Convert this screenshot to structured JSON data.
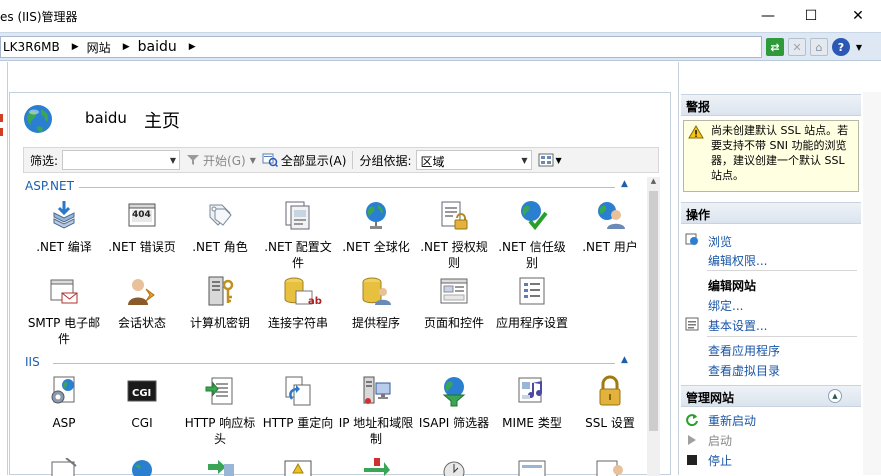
{
  "window": {
    "title": "es (IIS)管理器",
    "minimize": "—",
    "maximize": "☐",
    "close": "✕"
  },
  "address": {
    "segments": [
      "LK3R6MB",
      "网站",
      "baidu"
    ]
  },
  "header": {
    "site_name": "baidu",
    "title": "主页"
  },
  "filterbar": {
    "filter_label": "筛选:",
    "start_label": "开始(G)",
    "show_all_label": "全部显示(A)",
    "group_label": "分组依据:",
    "group_value": "区域"
  },
  "groups": [
    {
      "name": "ASP.NET",
      "items": [
        {
          "label": ".NET 编译",
          "icon": "net-compile-icon"
        },
        {
          "label": ".NET 错误页",
          "icon": "net-error-pages-icon"
        },
        {
          "label": ".NET 角色",
          "icon": "net-roles-icon"
        },
        {
          "label": ".NET 配置文件",
          "icon": "net-profile-icon"
        },
        {
          "label": ".NET 全球化",
          "icon": "net-globalization-icon"
        },
        {
          "label": ".NET 授权规则",
          "icon": "net-authorization-icon"
        },
        {
          "label": ".NET 信任级别",
          "icon": "net-trust-icon"
        },
        {
          "label": ".NET 用户",
          "icon": "net-users-icon"
        },
        {
          "label": "SMTP 电子邮件",
          "icon": "smtp-email-icon"
        },
        {
          "label": "会话状态",
          "icon": "session-state-icon"
        },
        {
          "label": "计算机密钥",
          "icon": "machine-key-icon"
        },
        {
          "label": "连接字符串",
          "icon": "connection-strings-icon"
        },
        {
          "label": "提供程序",
          "icon": "providers-icon"
        },
        {
          "label": "页面和控件",
          "icon": "pages-controls-icon"
        },
        {
          "label": "应用程序设置",
          "icon": "app-settings-icon"
        }
      ]
    },
    {
      "name": "IIS",
      "items": [
        {
          "label": "ASP",
          "icon": "asp-icon"
        },
        {
          "label": "CGI",
          "icon": "cgi-icon"
        },
        {
          "label": "HTTP 响应标头",
          "icon": "http-headers-icon"
        },
        {
          "label": "HTTP 重定向",
          "icon": "http-redirect-icon"
        },
        {
          "label": "IP 地址和域限制",
          "icon": "ip-restrictions-icon"
        },
        {
          "label": "ISAPI 筛选器",
          "icon": "isapi-filters-icon"
        },
        {
          "label": "MIME 类型",
          "icon": "mime-types-icon"
        },
        {
          "label": "SSL 设置",
          "icon": "ssl-settings-icon"
        }
      ]
    }
  ],
  "cgi_badge": "CGI",
  "badge_404": "404",
  "badge_ab": "ab",
  "actions": {
    "alerts_title": "警报",
    "alert_text": "尚未创建默认 SSL 站点。若要支持不带 SNI 功能的浏览器，建议创建一个默认 SSL 站点。",
    "actions_title": "操作",
    "browse": "浏览",
    "edit_permissions": "编辑权限...",
    "edit_site_title": "编辑网站",
    "bindings": "绑定...",
    "basic_settings": "基本设置...",
    "view_apps": "查看应用程序",
    "view_vdirs": "查看虚拟目录",
    "manage_title": "管理网站",
    "restart": "重新启动",
    "start": "启动",
    "stop": "停止"
  },
  "colors": {
    "link": "#1a56a6",
    "group_header": "#1b5fae",
    "alert_bg": "#ffffe1"
  }
}
